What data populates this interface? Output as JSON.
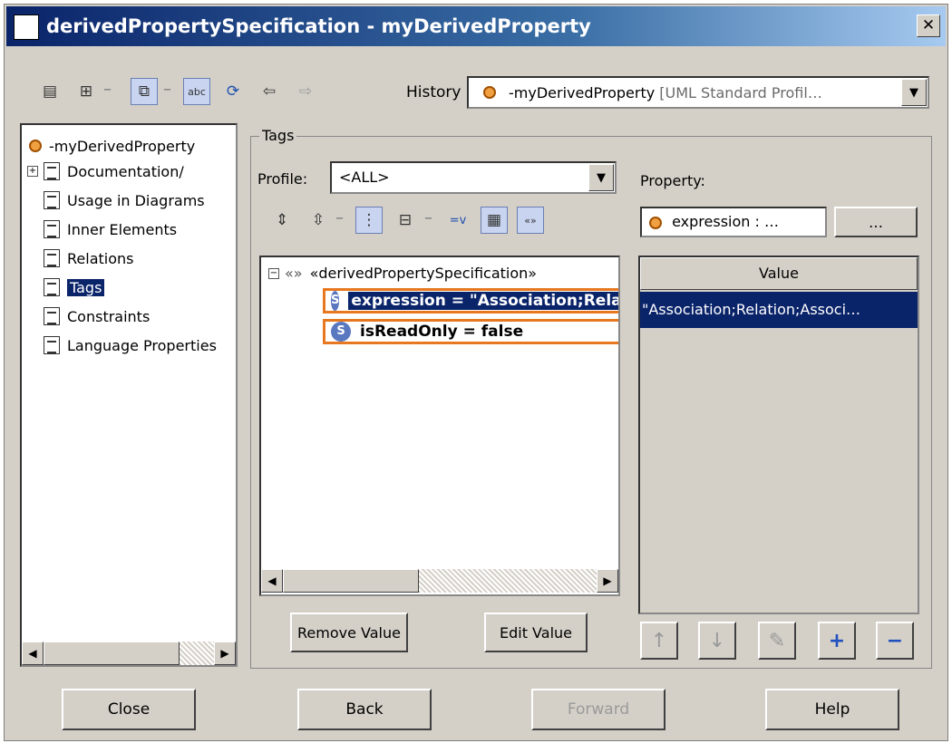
{
  "window": {
    "title": "derivedPropertySpecification - myDerivedProperty",
    "close_glyph": "✕"
  },
  "toolbar": {
    "history_label": "History :",
    "history_value": "-myDerivedProperty",
    "history_suffix": "[UML Standard Profil…"
  },
  "tree": {
    "root": "-myDerivedProperty",
    "items": [
      {
        "label": "Documentation/"
      },
      {
        "label": "Usage in Diagrams"
      },
      {
        "label": "Inner Elements"
      },
      {
        "label": "Relations"
      },
      {
        "label": "Tags"
      },
      {
        "label": "Constraints"
      },
      {
        "label": "Language Properties"
      }
    ]
  },
  "tags": {
    "group_label": "Tags",
    "profile_label": "Profile:",
    "profile_value": "<ALL>",
    "stereotype": "«derivedPropertySpecification»",
    "rows": [
      {
        "text": "expression = \"Association;Relation;Association\""
      },
      {
        "text": "isReadOnly = false"
      }
    ],
    "remove_value": "Remove Value",
    "edit_value": "Edit Value"
  },
  "property": {
    "label": "Property:",
    "field_value": "expression : …",
    "dots_button": "…",
    "value_header": "Value",
    "value_cell": "\"Association;Relation;Associ…"
  },
  "buttons": {
    "close": "Close",
    "back": "Back",
    "forward": "Forward",
    "help": "Help"
  }
}
